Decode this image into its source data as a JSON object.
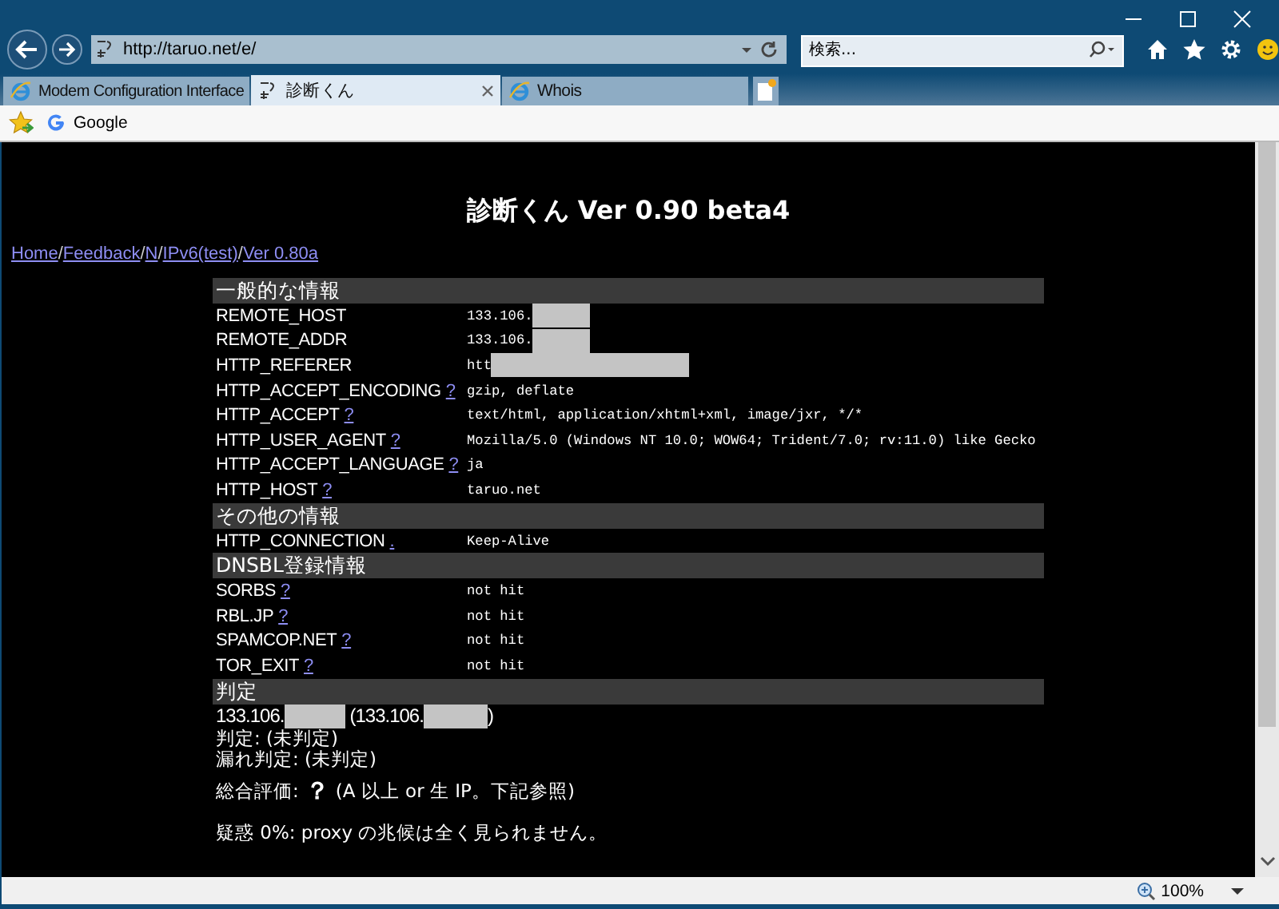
{
  "browser": {
    "address": "http://taruo.net/e/",
    "search_placeholder": "検索...",
    "zoom": "100%",
    "tabs": [
      {
        "title": "Modem Configuration Interface",
        "selected": false
      },
      {
        "title": "診断くん",
        "selected": true
      },
      {
        "title": "Whois",
        "selected": false
      }
    ],
    "favorites": [
      {
        "label": "Google"
      }
    ]
  },
  "page": {
    "title": "診断くん Ver 0.90 beta4",
    "nav_links": [
      "Home",
      "Feedback",
      "N",
      "IPv6(test)",
      "Ver 0.80a"
    ],
    "nav_separator": "/",
    "sections": [
      {
        "heading": "一般的な情報",
        "rows": [
          {
            "label": "REMOTE_HOST",
            "value": "133.106.",
            "kind": "ip"
          },
          {
            "label": "REMOTE_ADDR",
            "value": "133.106.",
            "kind": "ip"
          },
          {
            "label": "HTTP_REFERER",
            "value": "htt",
            "kind": "url"
          },
          {
            "label": "HTTP_ACCEPT_ENCODING",
            "help": "?",
            "value": "gzip, deflate"
          },
          {
            "label": "HTTP_ACCEPT",
            "help": "?",
            "value": "text/html, application/xhtml+xml, image/jxr, */*"
          },
          {
            "label": "HTTP_USER_AGENT",
            "help": "?",
            "value": "Mozilla/5.0 (Windows NT 10.0; WOW64; Trident/7.0; rv:11.0) like Gecko"
          },
          {
            "label": "HTTP_ACCEPT_LANGUAGE",
            "help": "?",
            "value": "ja"
          },
          {
            "label": "HTTP_HOST",
            "help": "?",
            "value": "taruo.net"
          }
        ]
      },
      {
        "heading": "その他の情報",
        "rows": [
          {
            "label": "HTTP_CONNECTION",
            "help": ".",
            "value": "Keep-Alive"
          }
        ]
      },
      {
        "heading": "DNSBL登録情報",
        "rows": [
          {
            "label": "SORBS",
            "help": "?",
            "value": "not hit"
          },
          {
            "label": "RBL.JP",
            "help": "?",
            "value": "not hit"
          },
          {
            "label": "SPAMCOP.NET",
            "help": "?",
            "value": "not hit"
          },
          {
            "label": "TOR_EXIT",
            "help": "?",
            "value": "not hit"
          }
        ]
      }
    ],
    "verdict": {
      "heading": "判定",
      "host": "133.106.",
      "addr": "(133.106.",
      "close": ")",
      "lines": [
        "判定: (未判定)",
        "漏れ判定: (未判定)"
      ],
      "overall_label": "総合評価:",
      "overall_mark": "？",
      "overall_note": "(A 以上 or 生 IP。下記参照)",
      "suspicion": "疑惑 0%: proxy の兆候は全く見られません。"
    }
  }
}
